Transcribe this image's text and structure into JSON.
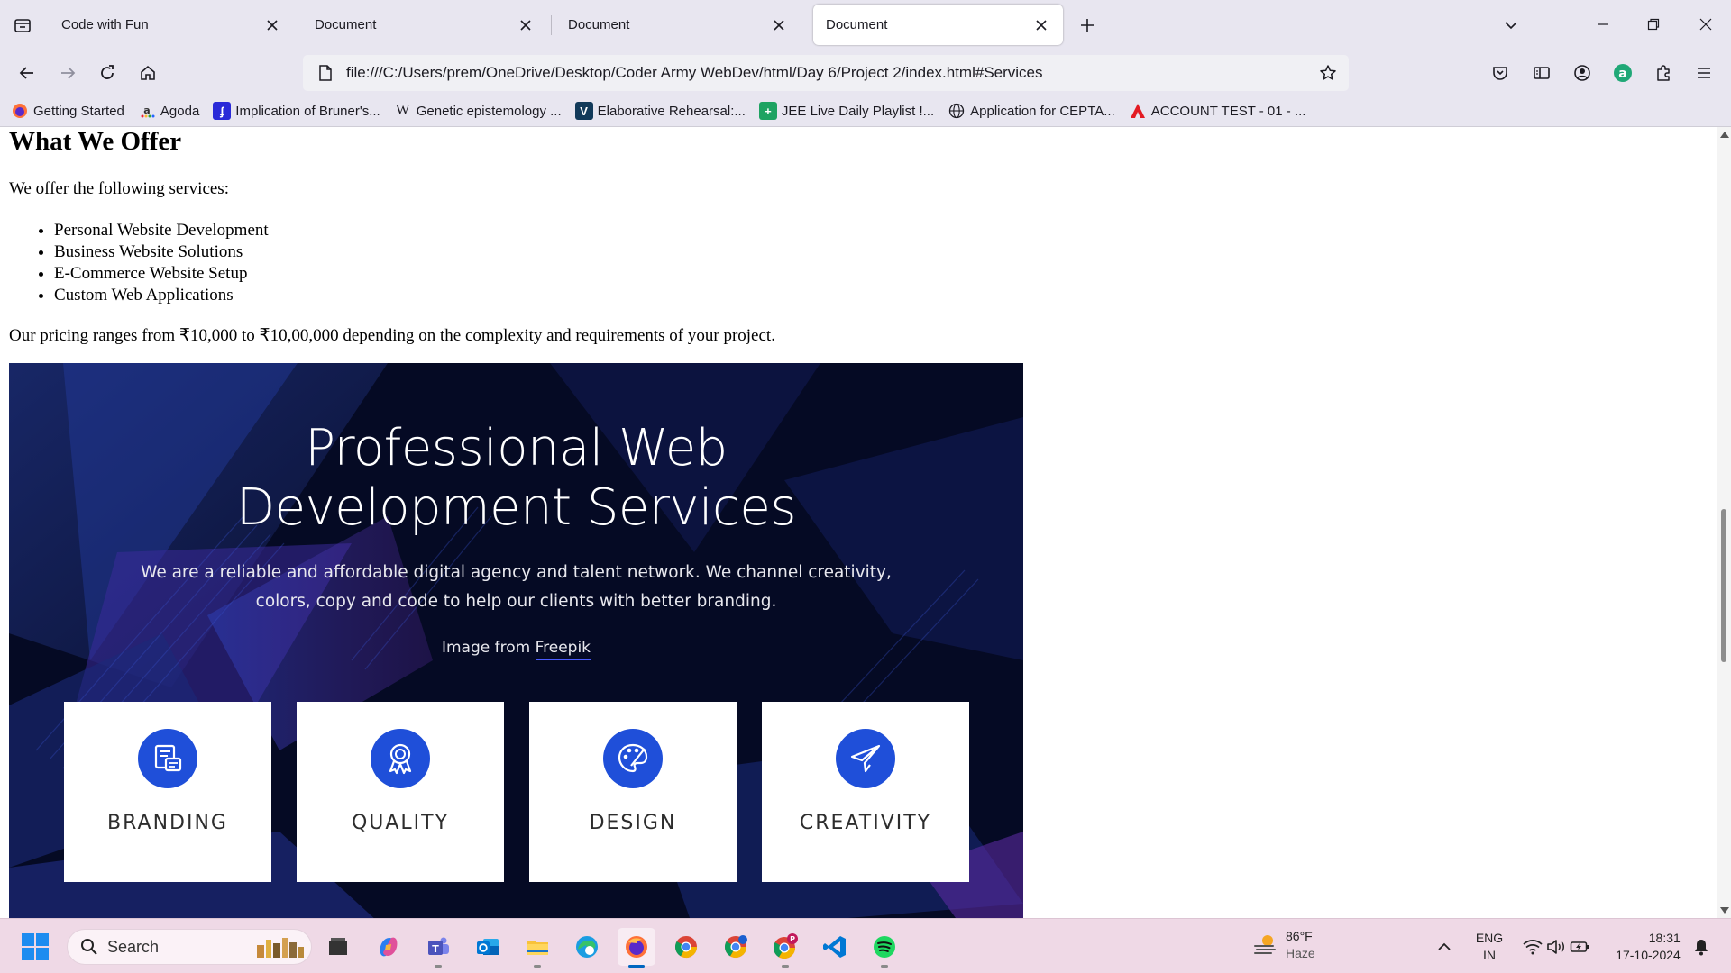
{
  "browser": {
    "tabs": [
      {
        "title": "Code with Fun",
        "active": false
      },
      {
        "title": "Document",
        "active": false
      },
      {
        "title": "Document",
        "active": false
      },
      {
        "title": "Document",
        "active": true
      }
    ],
    "url": "file:///C:/Users/prem/OneDrive/Desktop/Coder Army WebDev/html/Day 6/Project 2/index.html#Services",
    "bookmarks": [
      {
        "label": "Getting Started",
        "icon": "firefox-icon"
      },
      {
        "label": "Agoda",
        "icon": "agoda-icon"
      },
      {
        "label": "Implication of Bruner's...",
        "icon": "jstor-icon"
      },
      {
        "label": "Genetic epistemology ...",
        "icon": "wikipedia-icon"
      },
      {
        "label": "Elaborative Rehearsal:...",
        "icon": "verywell-icon"
      },
      {
        "label": "JEE Live Daily Playlist !...",
        "icon": "sheets-icon"
      },
      {
        "label": "Application for CEPTA...",
        "icon": "globe-icon"
      },
      {
        "label": "ACCOUNT TEST - 01 - ...",
        "icon": "account-icon"
      }
    ],
    "profile_initial": "a"
  },
  "page": {
    "heading": "What We Offer",
    "intro": "We offer the following services:",
    "services": [
      "Personal Website Development",
      "Business Website Solutions",
      "E-Commerce Website Setup",
      "Custom Web Applications"
    ],
    "pricing": "Our pricing ranges from ₹10,000 to ₹10,00,000 depending on the complexity and requirements of your project.",
    "banner": {
      "title_line1": "Professional Web",
      "title_line2": "Development Services",
      "desc_line1": "We are a reliable and affordable digital agency and talent network. We channel creativity,",
      "desc_line2": "colors, copy and code to help our clients with better branding.",
      "credit_prefix": "Image from",
      "credit_link": "Freepik",
      "cards": [
        {
          "label": "BRANDING",
          "icon": "branding-icon"
        },
        {
          "label": "QUALITY",
          "icon": "quality-badge-icon"
        },
        {
          "label": "DESIGN",
          "icon": "palette-icon"
        },
        {
          "label": "CREATIVITY",
          "icon": "paper-plane-icon"
        }
      ]
    }
  },
  "taskbar": {
    "search_label": "Search",
    "weather_temp": "86°F",
    "weather_desc": "Haze",
    "lang_line1": "ENG",
    "lang_line2": "IN",
    "time": "18:31",
    "date": "17-10-2024",
    "apps": [
      "file-explorer-dark-icon",
      "copilot-icon",
      "teams-icon",
      "outlook-icon",
      "folder-icon",
      "edge-icon",
      "firefox-icon",
      "chrome-icon",
      "chrome-profile-icon",
      "chrome-p-icon",
      "vscode-icon",
      "spotify-icon"
    ]
  },
  "colors": {
    "chrome_bg": "#e8e6f0",
    "banner_bg": "#050a24",
    "icon_blue": "#1f4fd9",
    "taskbar_bg": "#efd9e6"
  }
}
